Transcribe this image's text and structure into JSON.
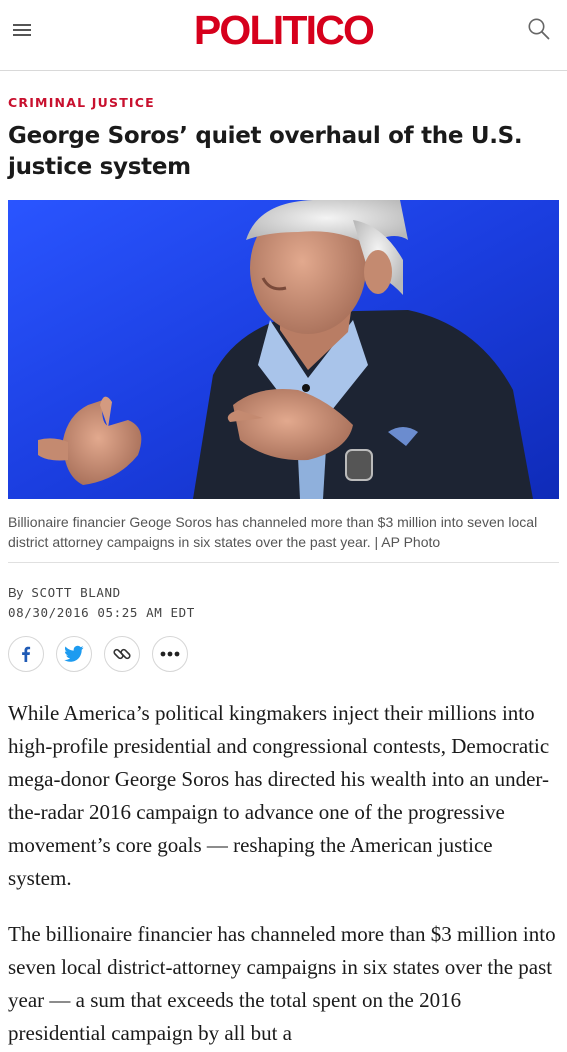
{
  "header": {
    "logo": "POLITICO",
    "menu_icon": "hamburger-menu-icon",
    "search_icon": "search-icon",
    "brand_color": "#d6001c"
  },
  "article": {
    "kicker": "CRIMINAL JUSTICE",
    "headline": "George Soros’ quiet overhaul of the U.S. justice system",
    "caption": "Billionaire financier Geoge Soros has channeled more than $3 million into seven local district attorney campaigns in six states over the past year. | AP Photo",
    "byline_prefix": "By",
    "author": "SCOTT BLAND",
    "timestamp": "08/30/2016 05:25 AM EDT",
    "paragraphs": [
      "While America’s political kingmakers inject their millions into high-profile presidential and congressional contests, Democratic mega-donor George Soros has directed his wealth into an under-the-radar 2016 campaign to advance one of the progressive movement’s core goals — reshaping the American justice system.",
      "The billionaire financier has channeled more than $3 million into seven local district-attorney campaigns in six states over the past year — a sum that exceeds the total spent on the 2016 presidential campaign by all but a"
    ]
  },
  "share": {
    "facebook_icon": "facebook-icon",
    "twitter_icon": "twitter-icon",
    "link_icon": "link-icon",
    "more_icon": "more-icon",
    "facebook_color": "#1f5ab5",
    "twitter_color": "#1d9bf0"
  }
}
